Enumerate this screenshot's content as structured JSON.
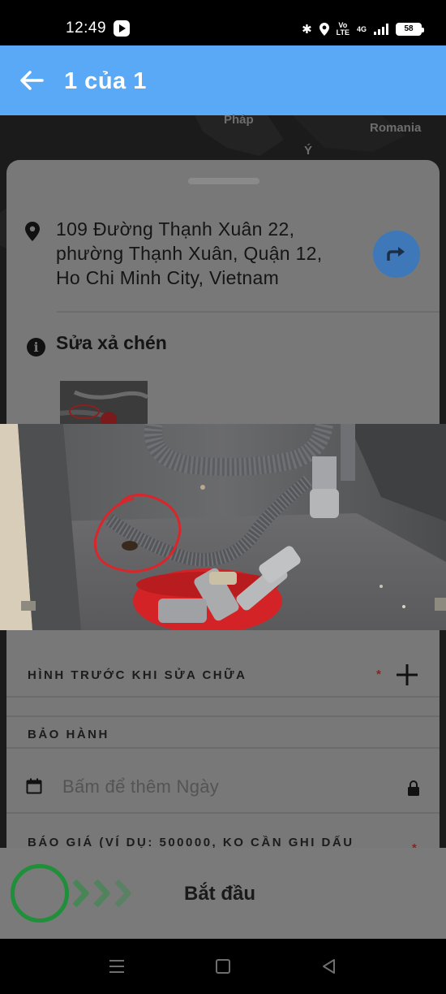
{
  "status_bar": {
    "time": "12:49",
    "network_type": "4G",
    "volte_line1": "Vo",
    "volte_line2": "LTE",
    "battery": "58"
  },
  "app_bar": {
    "title": "1 của 1"
  },
  "map": {
    "labels": [
      "Pháp",
      "Romania",
      "Ý"
    ]
  },
  "job": {
    "address_line1": "109 Đường Thạnh Xuân 22,",
    "address_line2": "phường Thạnh Xuân, Quận 12,",
    "address_line3": "Ho Chi Minh City, Vietnam",
    "title": "Sửa xả chén"
  },
  "form": {
    "before_photos_label": "HÌNH TRƯỚC KHI SỬA CHỮA",
    "warranty_label": "BẢO HÀNH",
    "date_placeholder": "Bấm để thêm Ngày",
    "quote_label": "BÁO GIÁ (VÍ DỤ: 500000, KO CẦN GHI DẤU",
    "required_marker": "*"
  },
  "slider": {
    "label": "Bắt đầu"
  },
  "colors": {
    "app_bar": "#5aa9f7",
    "directions_button": "#3e78b8",
    "slider_knob": "#1f8f3a",
    "required": "#9b1c1c",
    "annotation_circle": "#d8262b"
  }
}
